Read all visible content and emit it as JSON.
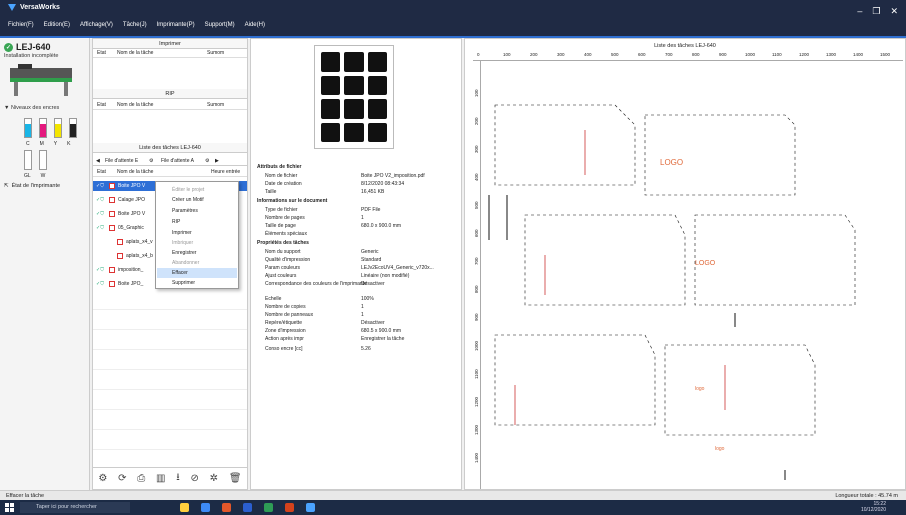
{
  "app": {
    "title": "VersaWorks",
    "menu": [
      "Fichier(F)",
      "Edition(E)",
      "Affichage(V)",
      "Tâche(J)",
      "Imprimante(P)",
      "Support(M)",
      "Aide(H)"
    ],
    "window_controls": [
      "–",
      "❐",
      "✕"
    ]
  },
  "printer": {
    "name": "LEJ-640",
    "install_status": "Installation incomplète",
    "ink_title": "Niveaux des encres",
    "ink_labels": [
      "C",
      "M",
      "Y",
      "K"
    ],
    "ink_labels2": [
      "GL",
      "W"
    ],
    "status_link": "État de l'imprimante",
    "colors": {
      "C": "#19b5e6",
      "M": "#e4197e",
      "Y": "#f3e500",
      "K": "#222222",
      "GL": "#dddddd",
      "W": "#ffffff"
    }
  },
  "queues": {
    "print_title": "Imprimer",
    "rip_title": "RIP",
    "list_title": "Liste des tâches LEJ-640",
    "columns": {
      "state": "Etat",
      "name": "Nom de la tâche",
      "extra": "Sumom"
    },
    "columns2": {
      "state": "Etat",
      "name": "Nom de la tâche",
      "time": "Heure entrée"
    },
    "tabs": [
      "File d'attente E",
      "File d'attente A"
    ],
    "jobs": [
      {
        "name": "Boite JPO V",
        "checked": true
      },
      {
        "name": "Calage JPO",
        "checked": true
      },
      {
        "name": "Boite JPO V",
        "checked": true
      },
      {
        "name": "05_Graphic",
        "checked": true
      },
      {
        "name": "aplats_x4_v",
        "checked": false
      },
      {
        "name": "aplats_x4_b",
        "checked": false
      },
      {
        "name": "imposition_",
        "checked": true
      },
      {
        "name": "Boite JPO_",
        "checked": true
      }
    ]
  },
  "context_menu": {
    "items": [
      {
        "label": "Éditer le projet",
        "disabled": true
      },
      {
        "label": "Créer un Motif",
        "disabled": false
      },
      {
        "label": "Paramètres",
        "disabled": false
      },
      {
        "label": "RIP",
        "disabled": false
      },
      {
        "label": "Imprimer",
        "disabled": false
      },
      {
        "label": "Imbriquer",
        "disabled": true
      },
      {
        "label": "Enregistrer",
        "disabled": false
      },
      {
        "label": "Abandonner",
        "disabled": true
      },
      {
        "label": "Effacer",
        "disabled": false
      },
      {
        "label": "Supprimer",
        "disabled": false
      }
    ]
  },
  "file_info": {
    "sections": [
      {
        "title": "Attributs de fichier",
        "rows": [
          [
            "Nom de fichier",
            "Boite JPO V2_imposition.pdf"
          ],
          [
            "Date de création",
            "8/12/2020 08:43:34"
          ],
          [
            "Taille",
            "16,451 KB"
          ]
        ]
      },
      {
        "title": "Informations sur le document",
        "rows": [
          [
            "Type de fichier",
            "PDF File"
          ],
          [
            "Nombre de pages",
            "1"
          ],
          [
            "Taille de page",
            "680.0 x 900.0 mm"
          ],
          [
            "Éléments spéciaux",
            ""
          ]
        ]
      },
      {
        "title": "Propriétés des tâches",
        "rows": [
          [
            "Nom du support",
            "Generic"
          ],
          [
            "Qualité d'impression",
            "Standard"
          ],
          [
            "Param couleurs",
            "LEJv2EcoUV4_Generic_v720x..."
          ],
          [
            "Ajust couleurs",
            "Linéaire (non modifié)"
          ],
          [
            "Correspondance des couleurs de l'imprimante",
            "Désactiver"
          ]
        ]
      },
      {
        "title": "",
        "rows": [
          [
            "Echelle",
            "100%"
          ],
          [
            "Nombre de copies",
            "1"
          ],
          [
            "Nombre de panneaux",
            "1"
          ],
          [
            "Repère/étiquette",
            "Désactiver"
          ],
          [
            "Zone d'impression",
            "680.5 x 900.0 mm"
          ],
          [
            "Action après impr",
            "Enregistrer la tâche"
          ],
          [
            "Conso encre [cc]",
            "5.26"
          ]
        ]
      }
    ]
  },
  "preview": {
    "title": "Liste des tâches LEJ-640",
    "ruler_h": [
      "0",
      "100",
      "200",
      "300",
      "400",
      "500",
      "600",
      "700",
      "800",
      "900",
      "1000",
      "1100",
      "1200",
      "1300",
      "1400",
      "1500"
    ],
    "ruler_v": [
      "100",
      "200",
      "300",
      "400",
      "500",
      "600",
      "700",
      "800",
      "900",
      "1000",
      "1100",
      "1200",
      "1300",
      "1400",
      "1500"
    ]
  },
  "statusbar": {
    "left": "Effacer la tâche",
    "right": "Longueur totale : 45.74 m"
  },
  "taskbar": {
    "search_placeholder": "Taper ici pour rechercher",
    "time": "15:22",
    "date": "10/12/2020"
  }
}
